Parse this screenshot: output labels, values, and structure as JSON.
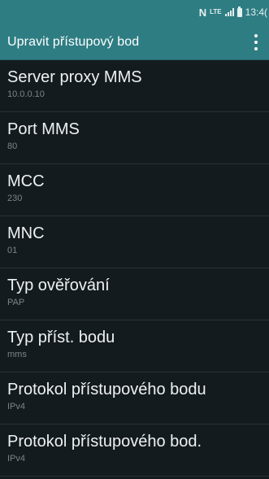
{
  "status_bar": {
    "nfc": "N",
    "network": "LTE",
    "time": "13:4("
  },
  "action_bar": {
    "title": "Upravit přístupový bod"
  },
  "settings": [
    {
      "title": "Server proxy MMS",
      "value": "10.0.0.10"
    },
    {
      "title": "Port MMS",
      "value": "80"
    },
    {
      "title": "MCC",
      "value": "230"
    },
    {
      "title": "MNC",
      "value": "01"
    },
    {
      "title": "Typ ověřování",
      "value": "PAP"
    },
    {
      "title": "Typ příst. bodu",
      "value": "mms"
    },
    {
      "title": "Protokol přístupového bodu",
      "value": "IPv4"
    },
    {
      "title": "Protokol přístupového bod.",
      "value": "IPv4"
    }
  ],
  "colors": {
    "accent": "#2e7d83",
    "background": "#141b1f",
    "secondary_text": "#79858a"
  }
}
